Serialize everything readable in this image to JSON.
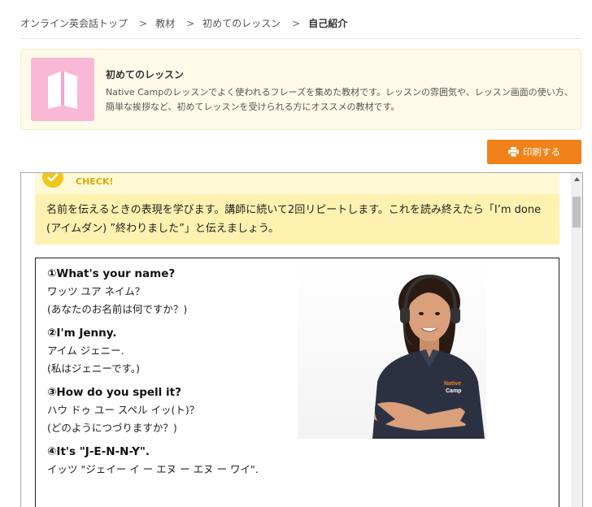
{
  "breadcrumb": {
    "items": [
      "オンライン英会話トップ",
      "教材",
      "初めてのレッスン"
    ],
    "separator": ">",
    "current": "自己紹介"
  },
  "card": {
    "title": "初めてのレッスン",
    "description": "Native Campのレッスンでよく使われるフレーズを集めた教材です。レッスンの雰囲気や、レッスン画面の使い方、簡単な挨拶など、初めてレッスンを受けられる方にオススメの教材です。",
    "thumb_icon": "book-icon",
    "thumb_color": "#f9b8d6"
  },
  "print_button": {
    "label": "印刷する",
    "icon": "printer-icon",
    "color": "#f08219"
  },
  "check": {
    "label": "CHECK!",
    "text": "名前を伝えるときの表現を学びます。講師に続いて2回リピートします。これを読み終えたら「I’m done (アイムダン) ”終わりました”」と伝えましょう。"
  },
  "phrases": [
    {
      "en": "①What's your name?",
      "kana": "ワッツ ユア ネイム？",
      "ja": "(あなたのお名前は何ですか？)"
    },
    {
      "en": "②I'm Jenny.",
      "kana": "アイム ジェニー.",
      "ja": "(私はジェニーです。)"
    },
    {
      "en": "③How do you spell it?",
      "kana": "ハウ ドゥ ユー スペル イッ(ト)？",
      "ja": "(どのようにつづりますか？)"
    },
    {
      "en": "④It's \"J-E-N-N-Y\".",
      "kana": "イッツ \"ジェイー イ ー エヌ ー エヌ ー ワイ\".",
      "ja": ""
    }
  ],
  "photo": {
    "shirt_logo_line1": "Native",
    "shirt_logo_line2": "Camp"
  }
}
